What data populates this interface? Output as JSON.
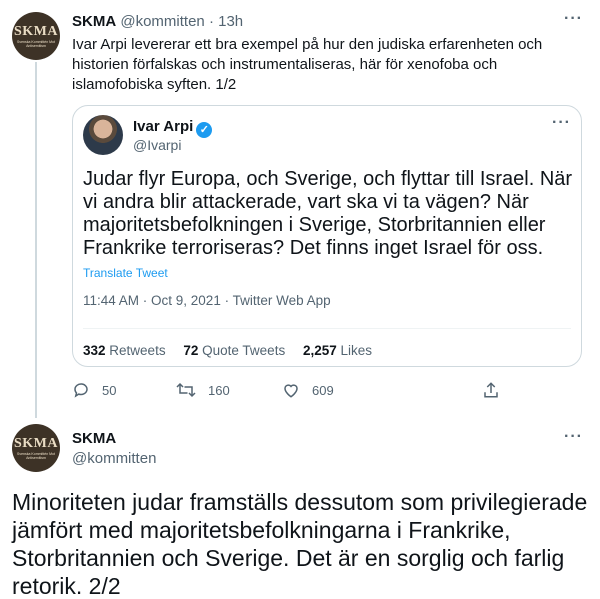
{
  "tweet1": {
    "avatar_text": "SKMA",
    "avatar_subtext": "Svenska Kommittén Mot Antisemitism",
    "name": "SKMA",
    "handle": "@kommitten",
    "time": "· 13h",
    "more_icon": "more-dots-icon",
    "body": "Ivar Arpi levererar ett bra exempel på hur den judiska erfarenheten och historien förfalskas och instrumentaliseras, här för xenofoba och islamofobiska syften.  1/2"
  },
  "quote": {
    "name": "Ivar Arpi",
    "verified_icon": "verified-badge-icon",
    "handle": "@Ivarpi",
    "body": "Judar flyr Europa, och Sverige, och flyttar till Israel. När vi andra blir attackerade, vart ska vi ta vägen? När majoritetsbefolkningen i Sverige, Storbritannien eller Frankrike terroriseras? Det finns inget Israel för oss.",
    "translate": "Translate Tweet",
    "meta": "11:44 AM · Oct 9, 2021 · Twitter Web App",
    "retweets_count": "332",
    "retweets_label": "Retweets",
    "quotes_count": "72",
    "quotes_label": "Quote Tweets",
    "likes_count": "2,257",
    "likes_label": "Likes"
  },
  "actions": {
    "reply_count": "50",
    "retweet_count": "160",
    "like_count": "609",
    "share_label": ""
  },
  "tweet2": {
    "avatar_text": "SKMA",
    "avatar_subtext": "Svenska Kommittén Mot Antisemitism",
    "name": "SKMA",
    "handle": "@kommitten",
    "body": "Minoriteten judar framställs dessutom som privilegierade jämfört med majoritetsbefolkningarna i Frankrike, Storbritannien och Sverige. Det är en sorglig och farlig retorik.  2/2"
  },
  "colors": {
    "accent": "#1d9bf0",
    "muted": "#536471",
    "avatar_bg": "#3d3226",
    "border": "#cfd9de"
  }
}
